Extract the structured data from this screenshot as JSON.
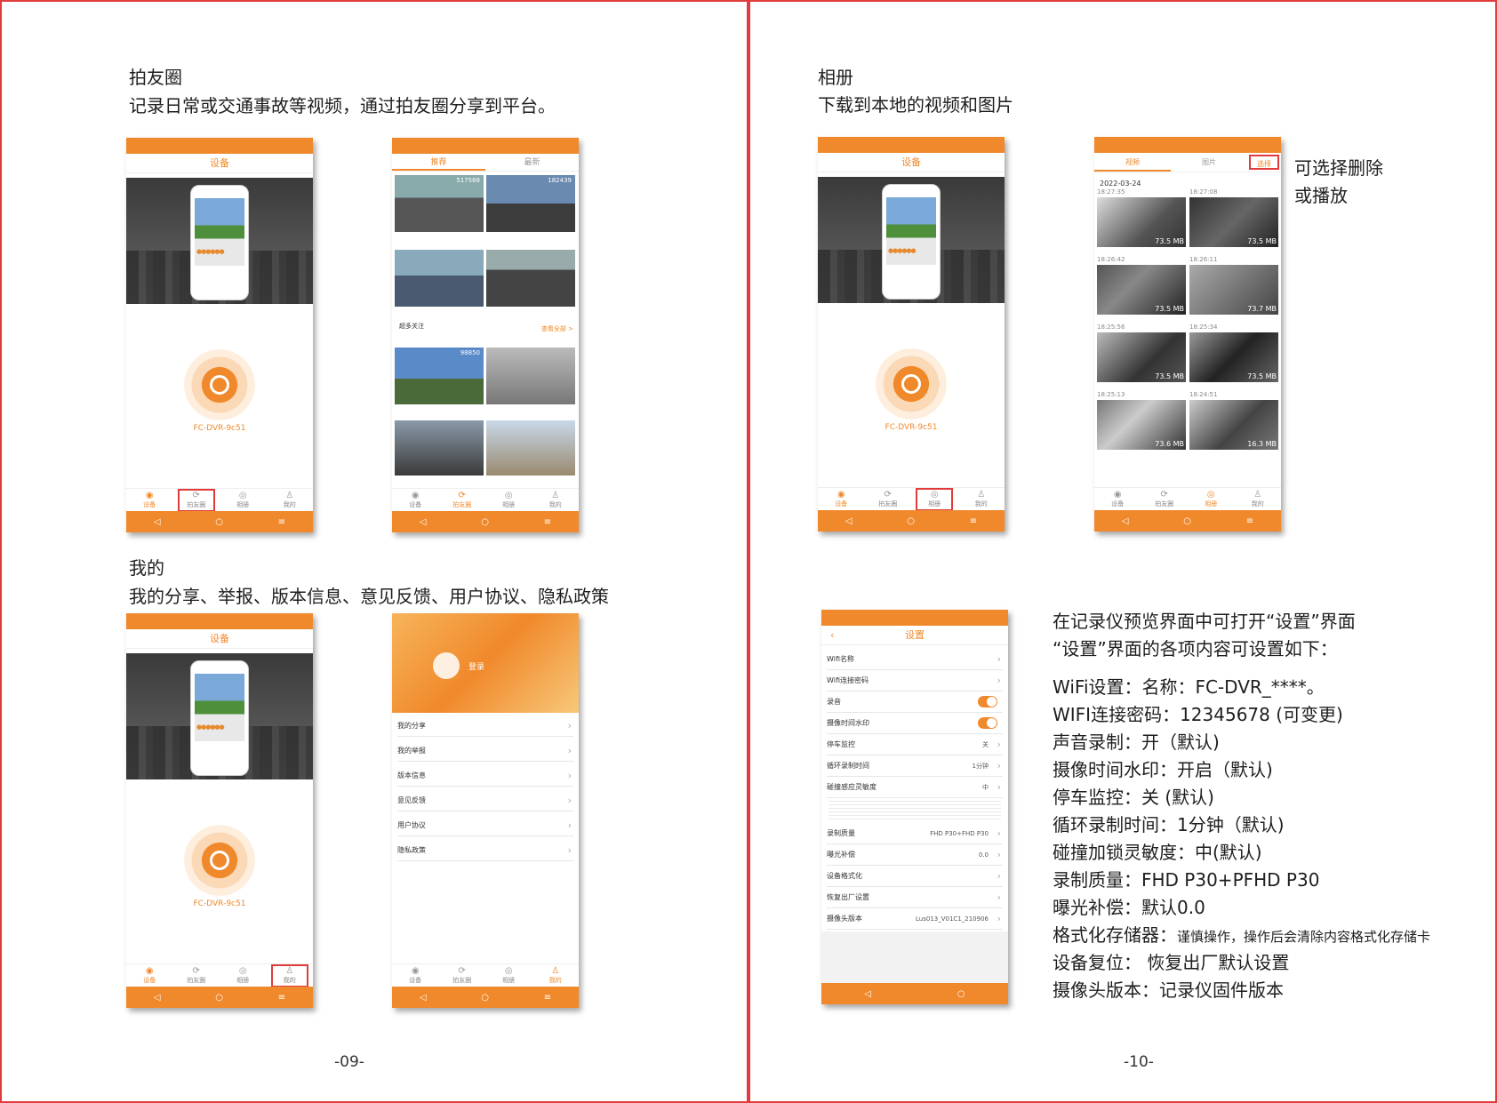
{
  "left": {
    "section1_title": "拍友圈",
    "section1_desc": "记录日常或交通事故等视频，通过拍友圈分享到平台。",
    "section2_title": "我的",
    "section2_desc": "我的分享、举报、版本信息、意见反馈、用户协议、隐私政策",
    "page_number": "-09-"
  },
  "right": {
    "section1_title": "相册",
    "section1_desc": "下载到本地的视频和图片",
    "album_note_1": "可选择删除",
    "album_note_2": "或播放",
    "settings_intro_1": "在记录仪预览界面中可打开“设置”界面",
    "settings_intro_2": "“设置”界面的各项内容可设置如下：",
    "settings_list": [
      "WiFi设置：名称：FC-DVR_****。",
      "WIFI连接密码：12345678 (可变更)",
      "声音录制：开（默认)",
      "摄像时间水印：开启（默认)",
      "停车监控：关 (默认)",
      "循环录制时间：1分钟（默认)",
      "碰撞加锁灵敏度：中(默认)",
      " 录制质量：FHD P30+PFHD P30",
      "曝光补偿：默认0.0",
      "设备复位：  恢复出厂默认设置",
      "摄像头版本：记录仪固件版本"
    ],
    "format_label": "格式化存储器：",
    "format_value": "谨慎操作，操作后会清除内容格式化存储卡",
    "page_number": "-10-"
  },
  "device_screen": {
    "title": "设备",
    "device_name": "FC-DVR-9c51"
  },
  "tabs": [
    "设备",
    "拍友圈",
    "相册",
    "我的"
  ],
  "nav_keys": [
    "◁",
    "○",
    "≡"
  ],
  "feed_screen": {
    "tab_recommend": "推荐",
    "tab_latest": "最新",
    "counts": [
      "517568",
      "182439",
      "98850"
    ],
    "section_label": "超多关注",
    "see_all": "查看全部 >"
  },
  "album_screen": {
    "tab_video": "视频",
    "tab_photo": "图片",
    "select": "选择",
    "date": "2022-03-24",
    "items": [
      {
        "time": "18:27:35",
        "size": "73.5 MB"
      },
      {
        "time": "18:27:08",
        "size": "73.5 MB"
      },
      {
        "time": "18:26:42",
        "size": "73.5 MB"
      },
      {
        "time": "18:26:11",
        "size": "73.7 MB"
      },
      {
        "time": "18:25:56",
        "size": "73.5 MB"
      },
      {
        "time": "18:25:34",
        "size": "73.5 MB"
      },
      {
        "time": "18:25:13",
        "size": "73.6 MB"
      },
      {
        "time": "18:24:51",
        "size": "16.3 MB"
      }
    ]
  },
  "mine_screen": {
    "username": "登录",
    "menu": [
      "我的分享",
      "我的举报",
      "版本信息",
      "意见反馈",
      "用户协议",
      "隐私政策"
    ]
  },
  "settings_screen": {
    "title": "设置",
    "rows": [
      {
        "label": "Wifi名称",
        "value": ""
      },
      {
        "label": "Wifi连接密码",
        "value": ""
      },
      {
        "label": "录音",
        "value": ""
      },
      {
        "label": "摄像时间水印",
        "value": ""
      },
      {
        "label": "停车监控",
        "value": "关"
      },
      {
        "label": "循环录制时间",
        "value": "1分钟"
      },
      {
        "label": "碰撞感应灵敏度",
        "value": "中"
      },
      {
        "label": "录制质量",
        "value": "FHD P30+FHD P30"
      },
      {
        "label": "曝光补偿",
        "value": "0.0"
      },
      {
        "label": "设备格式化",
        "value": ""
      },
      {
        "label": "恢复出厂设置",
        "value": ""
      },
      {
        "label": "摄像头版本",
        "value": "Lus013_V01C1_210906"
      }
    ]
  },
  "colors": {
    "accent": "#f0892b",
    "border": "#e23b3b"
  }
}
